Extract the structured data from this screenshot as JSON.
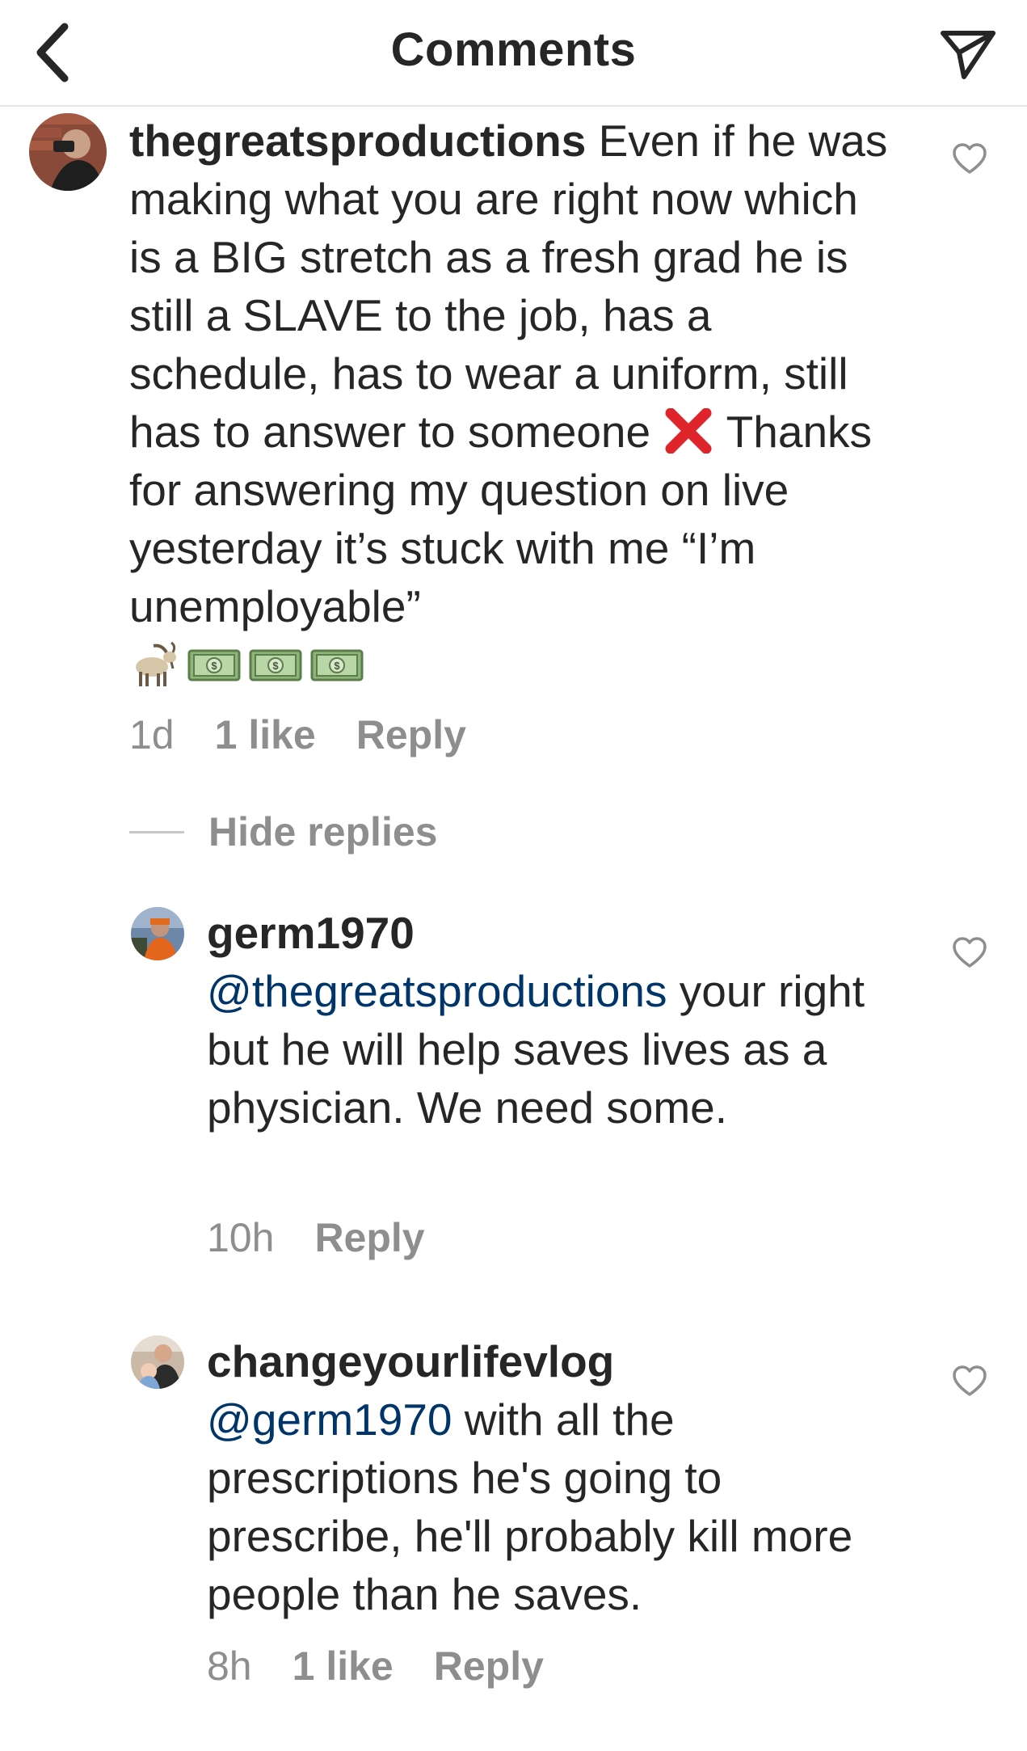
{
  "header": {
    "title": "Comments"
  },
  "comments": [
    {
      "username": "thegreatsproductions",
      "text": " Even if he was making what you are right now which is a BIG stretch as a fresh grad he is still a SLAVE to the job, has a schedule, has to wear a uniform, still has to answer to someone ",
      "emoji_inline": "cross-mark",
      "text_after": " Thanks for answering my question on live yesterday it’s stuck with me “I’m unemployable”",
      "emoji_row": [
        "goat",
        "money",
        "money",
        "money"
      ],
      "time": "1d",
      "likes": "1 like",
      "reply": "Reply"
    }
  ],
  "hide_replies": "Hide replies",
  "replies": [
    {
      "username": "germ1970",
      "mention": "@thegreatsproductions",
      "text": " your right but he will help saves lives as a physician. We need some.",
      "time": "10h",
      "reply": "Reply"
    },
    {
      "username": "changeyourlifevlog",
      "mention": "@germ1970",
      "text": " with all the prescriptions he's going to prescribe, he'll probably kill more people than he saves.",
      "time": "8h",
      "likes": "1 like",
      "reply": "Reply"
    }
  ],
  "colors": {
    "text": "#262626",
    "meta": "#8e8e8e",
    "mention": "#003569",
    "divider": "#e6e6e6"
  }
}
